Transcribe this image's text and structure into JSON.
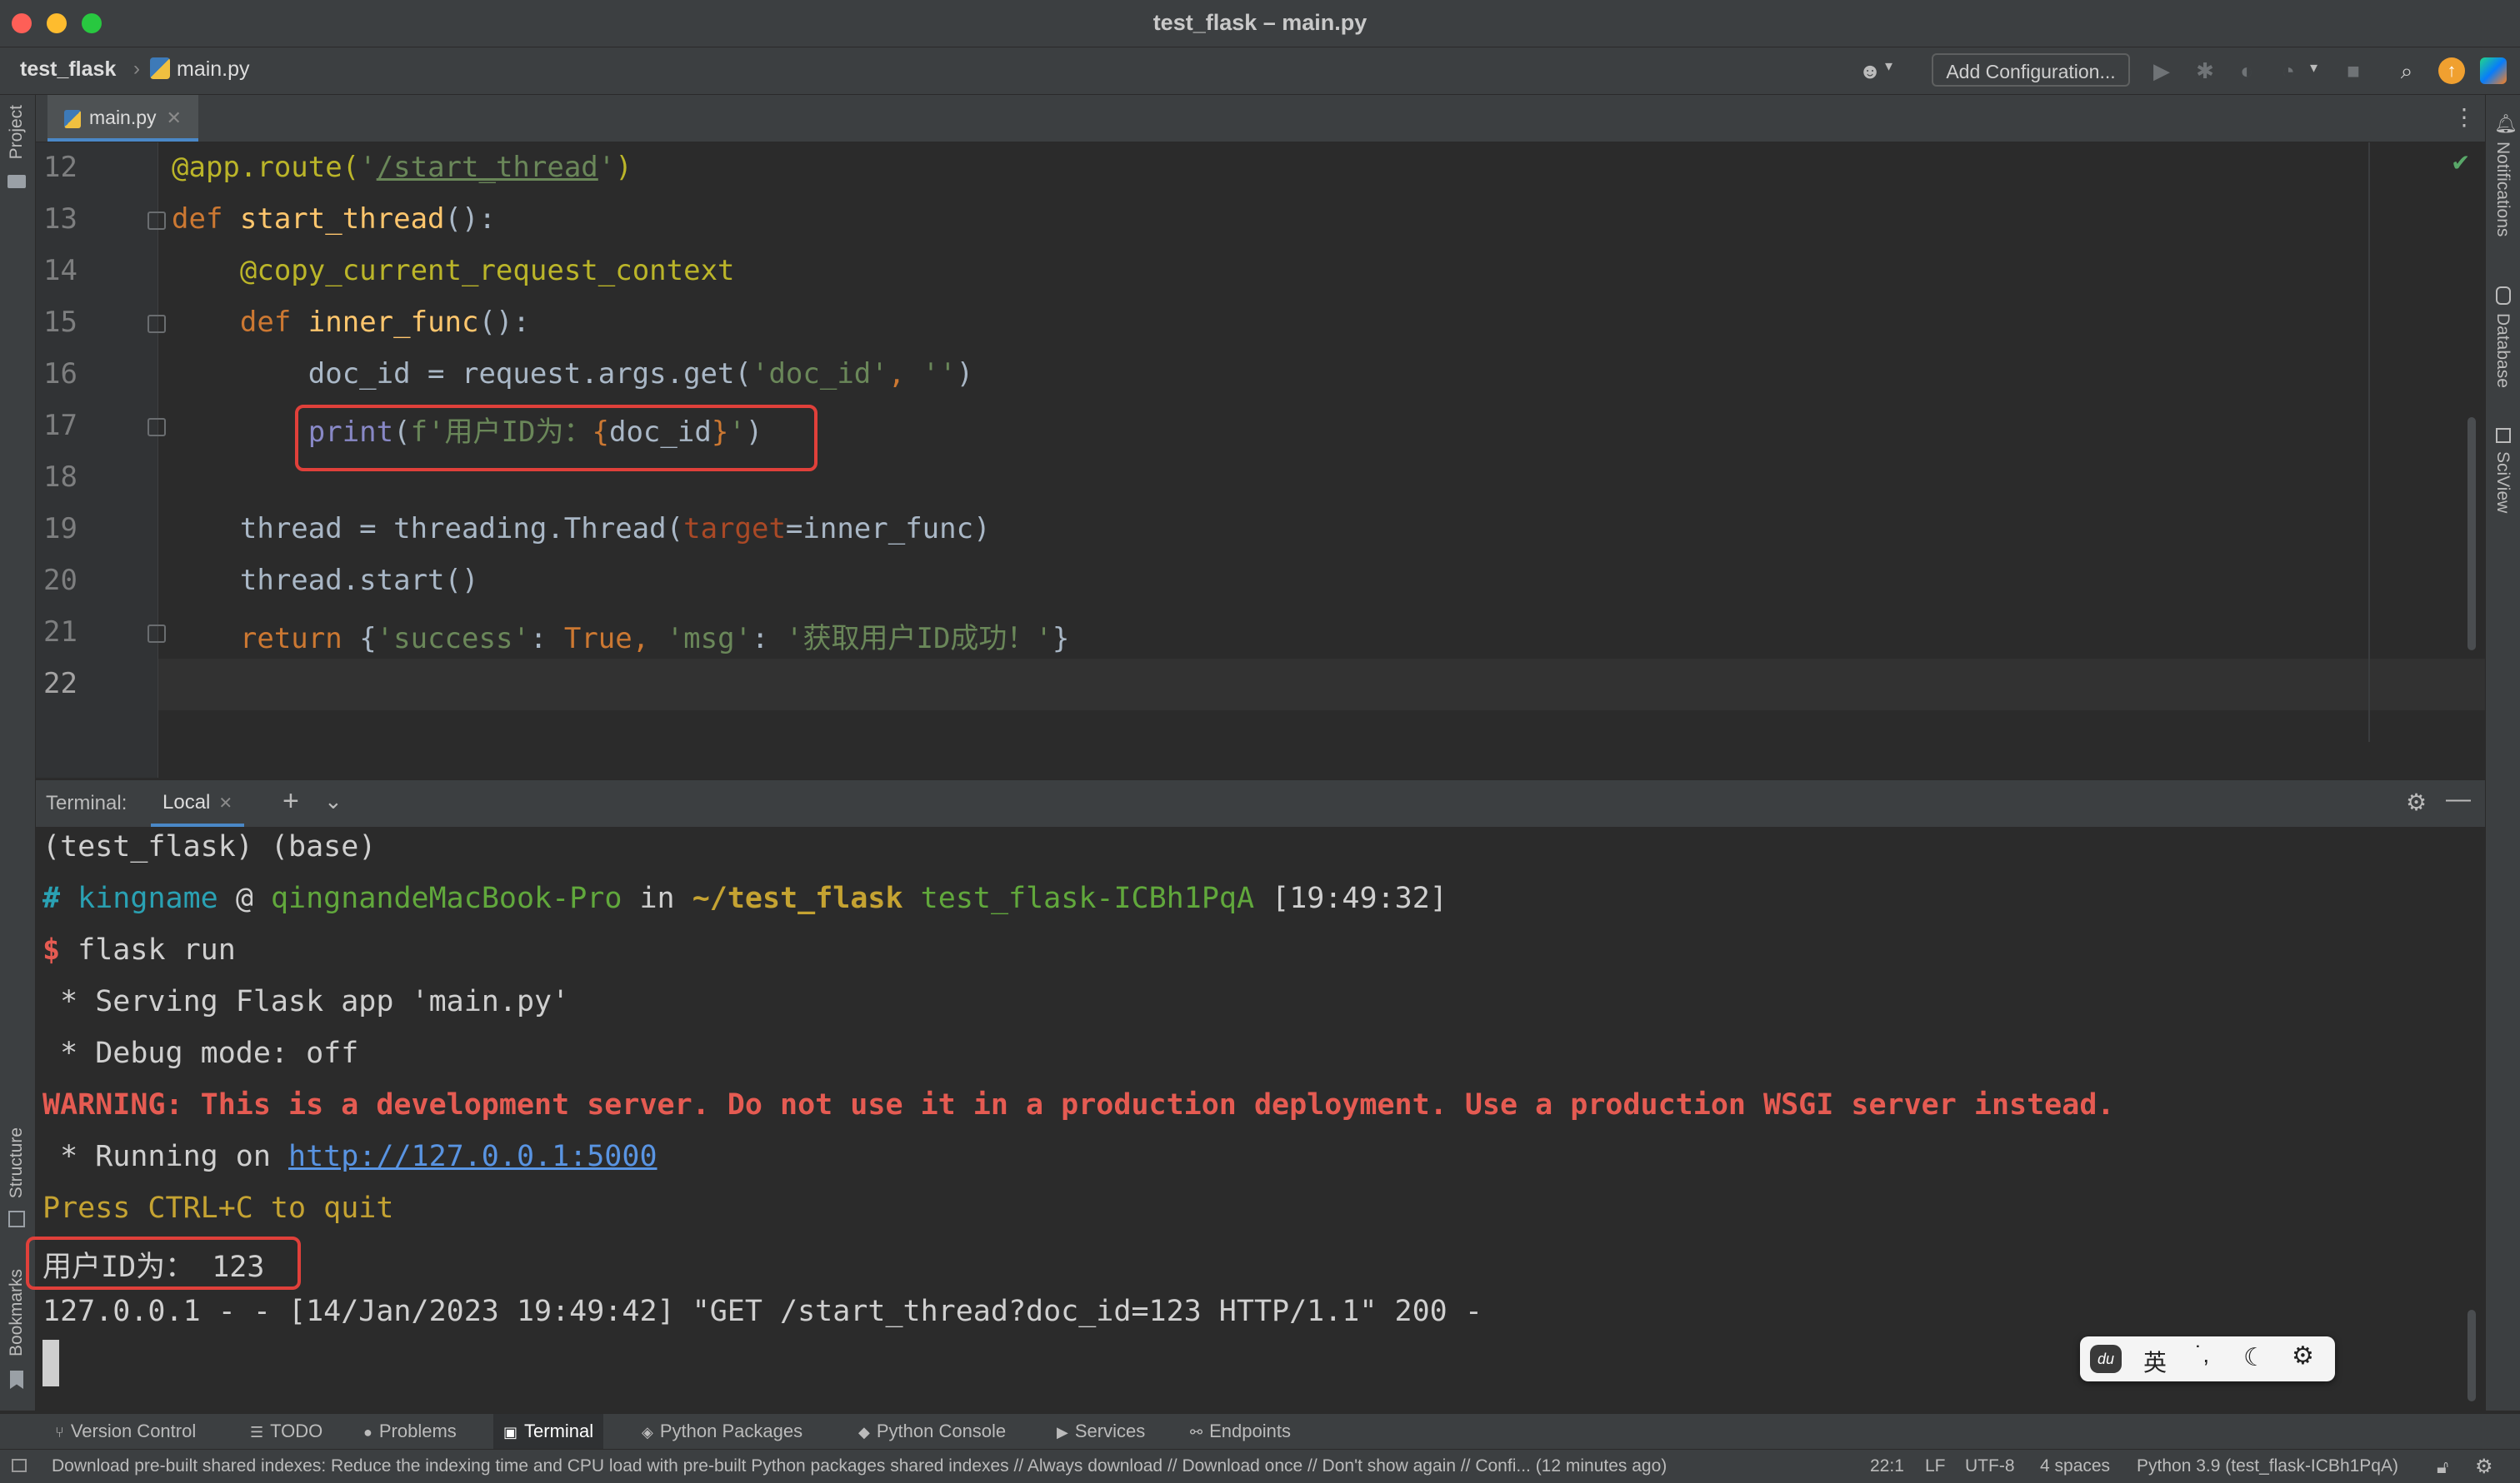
{
  "window": {
    "title": "test_flask – main.py",
    "traffic_colors": [
      "#fe5f57",
      "#febc2e",
      "#28c840"
    ]
  },
  "navbar": {
    "project": "test_flask",
    "file": "main.py",
    "add_config": "Add Configuration..."
  },
  "left_strip": {
    "project": "Project",
    "structure": "Structure",
    "bookmarks": "Bookmarks"
  },
  "right_strip": {
    "notifications": "Notifications",
    "database": "Database",
    "sciview": "SciView"
  },
  "editor": {
    "tab": "main.py",
    "lines": [
      {
        "n": "12",
        "tokens": [
          [
            "dec",
            "@app.route("
          ],
          [
            "str",
            "'"
          ],
          [
            "url",
            "/start_thread"
          ],
          [
            "str",
            "'"
          ],
          [
            "dec",
            ")"
          ]
        ]
      },
      {
        "n": "13",
        "tokens": [
          [
            "kw",
            "def "
          ],
          [
            "fn",
            "start_thread"
          ],
          [
            "plain",
            "():"
          ]
        ]
      },
      {
        "n": "14",
        "tokens": [
          [
            "plain",
            "    "
          ],
          [
            "dec",
            "@copy_current_request_context"
          ]
        ]
      },
      {
        "n": "15",
        "tokens": [
          [
            "plain",
            "    "
          ],
          [
            "kw",
            "def "
          ],
          [
            "fn",
            "inner_func"
          ],
          [
            "plain",
            "():"
          ]
        ]
      },
      {
        "n": "16",
        "tokens": [
          [
            "plain",
            "        doc_id = request.args.get("
          ],
          [
            "str",
            "'doc_id'"
          ],
          [
            "kw",
            ", "
          ],
          [
            "str",
            "''"
          ],
          [
            "plain",
            ")"
          ]
        ]
      },
      {
        "n": "17",
        "tokens": [
          [
            "plain",
            "        "
          ],
          [
            "bi",
            "print"
          ],
          [
            "plain",
            "("
          ],
          [
            "str",
            "f'用户ID为："
          ],
          [
            "kw",
            "{"
          ],
          [
            "plain",
            "doc_id"
          ],
          [
            "kw",
            "}"
          ],
          [
            "str",
            "'"
          ],
          [
            "plain",
            ")"
          ]
        ]
      },
      {
        "n": "18",
        "tokens": []
      },
      {
        "n": "19",
        "tokens": [
          [
            "plain",
            "    thread = threading.Thread("
          ],
          [
            "arg",
            "target"
          ],
          [
            "plain",
            "=inner_func)"
          ]
        ]
      },
      {
        "n": "20",
        "tokens": [
          [
            "plain",
            "    thread.start()"
          ]
        ]
      },
      {
        "n": "21",
        "tokens": [
          [
            "plain",
            "    "
          ],
          [
            "kw",
            "return "
          ],
          [
            "plain",
            "{"
          ],
          [
            "str",
            "'success'"
          ],
          [
            "plain",
            ": "
          ],
          [
            "kw",
            "True, "
          ],
          [
            "str",
            "'msg'"
          ],
          [
            "plain",
            ": "
          ],
          [
            "str",
            "'获取用户ID成功！'"
          ],
          [
            "plain",
            "}"
          ]
        ]
      },
      {
        "n": "22",
        "tokens": []
      }
    ]
  },
  "terminal": {
    "label": "Terminal:",
    "tab": "Local",
    "env": "(test_flask) (base)",
    "prompt": {
      "hash": "#",
      "user": "kingname",
      "at": "@",
      "host": "qingnandeMacBook-Pro",
      "in": "in",
      "dir": "~/test_flask",
      "venv": "test_flask-ICBh1PqA",
      "time": "[19:49:32]"
    },
    "dollar": "$",
    "command": "flask run",
    "serving": " * Serving Flask app 'main.py'",
    "debug": " * Debug mode: off",
    "warning": "WARNING: This is a development server. Do not use it in a production deployment. Use a production WSGI server instead.",
    "running_prefix": " * Running on ",
    "running_url": "http://127.0.0.1:5000",
    "press": "Press CTRL+C to quit",
    "output": "用户ID为： 123",
    "log": "127.0.0.1 - - [14/Jan/2023 19:49:42] \"GET /start_thread?doc_id=123 HTTP/1.1\" 200 -"
  },
  "ime": {
    "lang": "英",
    "punct": "˙,"
  },
  "tool_tabs": [
    {
      "icon": "⑂",
      "label": "Version Control",
      "name": "tool-version-control"
    },
    {
      "icon": "☰",
      "label": "TODO",
      "name": "tool-todo"
    },
    {
      "icon": "●",
      "label": "Problems",
      "name": "tool-problems"
    },
    {
      "icon": "▣",
      "label": "Terminal",
      "name": "tool-terminal"
    },
    {
      "icon": "◈",
      "label": "Python Packages",
      "name": "tool-python-packages"
    },
    {
      "icon": "◆",
      "label": "Python Console",
      "name": "tool-python-console"
    },
    {
      "icon": "▶",
      "label": "Services",
      "name": "tool-services"
    },
    {
      "icon": "⚯",
      "label": "Endpoints",
      "name": "tool-endpoints"
    }
  ],
  "statusbar": {
    "message": "Download pre-built shared indexes: Reduce the indexing time and CPU load with pre-built Python packages shared indexes // Always download // Download once // Don't show again // Confi... (12 minutes ago)",
    "position": "22:1",
    "line_sep": "LF",
    "encoding": "UTF-8",
    "indent": "4 spaces",
    "interpreter": "Python 3.9 (test_flask-ICBh1PqA)"
  }
}
